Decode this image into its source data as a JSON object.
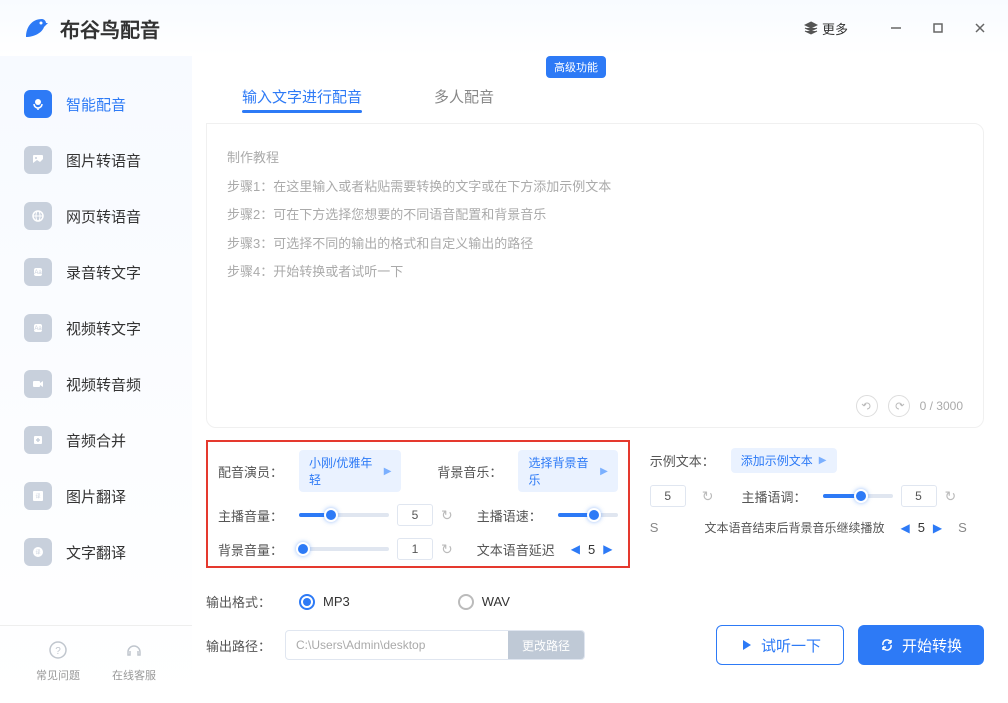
{
  "app": {
    "title": "布谷鸟配音",
    "more": "更多"
  },
  "sidebar": {
    "items": [
      {
        "label": "智能配音",
        "active": true,
        "icon": "mic"
      },
      {
        "label": "图片转语音",
        "active": false,
        "icon": "image"
      },
      {
        "label": "网页转语音",
        "active": false,
        "icon": "web"
      },
      {
        "label": "录音转文字",
        "active": false,
        "icon": "rec"
      },
      {
        "label": "视频转文字",
        "active": false,
        "icon": "video"
      },
      {
        "label": "视频转音频",
        "active": false,
        "icon": "videoaudio"
      },
      {
        "label": "音频合并",
        "active": false,
        "icon": "merge"
      },
      {
        "label": "图片翻译",
        "active": false,
        "icon": "imgtrans"
      },
      {
        "label": "文字翻译",
        "active": false,
        "icon": "texttrans"
      }
    ],
    "footer": {
      "faq": "常见问题",
      "support": "在线客服"
    }
  },
  "tabs": {
    "t1": "输入文字进行配音",
    "t2": "多人配音",
    "badge": "高级功能"
  },
  "textarea": {
    "placeholder": "制作教程\n步骤1：在这里输入或者粘贴需要转换的文字或在下方添加示例文本\n步骤2：可在下方选择您想要的不同语音配置和背景音乐\n步骤3：可选择不同的输出的格式和自定义输出的路径\n步骤4：开始转换或者试听一下",
    "counter": "0 / 3000"
  },
  "settings": {
    "actor_label": "配音演员：",
    "actor_value": "小刚/优雅年轻",
    "bgm_label": "背景音乐：",
    "bgm_value": "选择背景音乐",
    "sample_label": "示例文本：",
    "sample_value": "添加示例文本",
    "volume_label": "主播音量：",
    "volume_value": "5",
    "speed_label": "主播语速：",
    "speed_value": "5",
    "pitch_label": "主播语调：",
    "pitch_value": "5",
    "bgm_vol_label": "背景音量：",
    "bgm_vol_value": "1",
    "delay_label": "文本语音延迟",
    "delay_value": "5",
    "delay_suffix": "S",
    "bgm_after_label": "文本语音结束后背景音乐继续播放",
    "bgm_after_value": "5",
    "bgm_after_suffix": "S",
    "format_label": "输出格式：",
    "format_mp3": "MP3",
    "format_wav": "WAV",
    "path_label": "输出路径：",
    "path_value": "C:\\Users\\Admin\\desktop",
    "path_btn": "更改路径",
    "preview": "试听一下",
    "convert": "开始转换"
  }
}
